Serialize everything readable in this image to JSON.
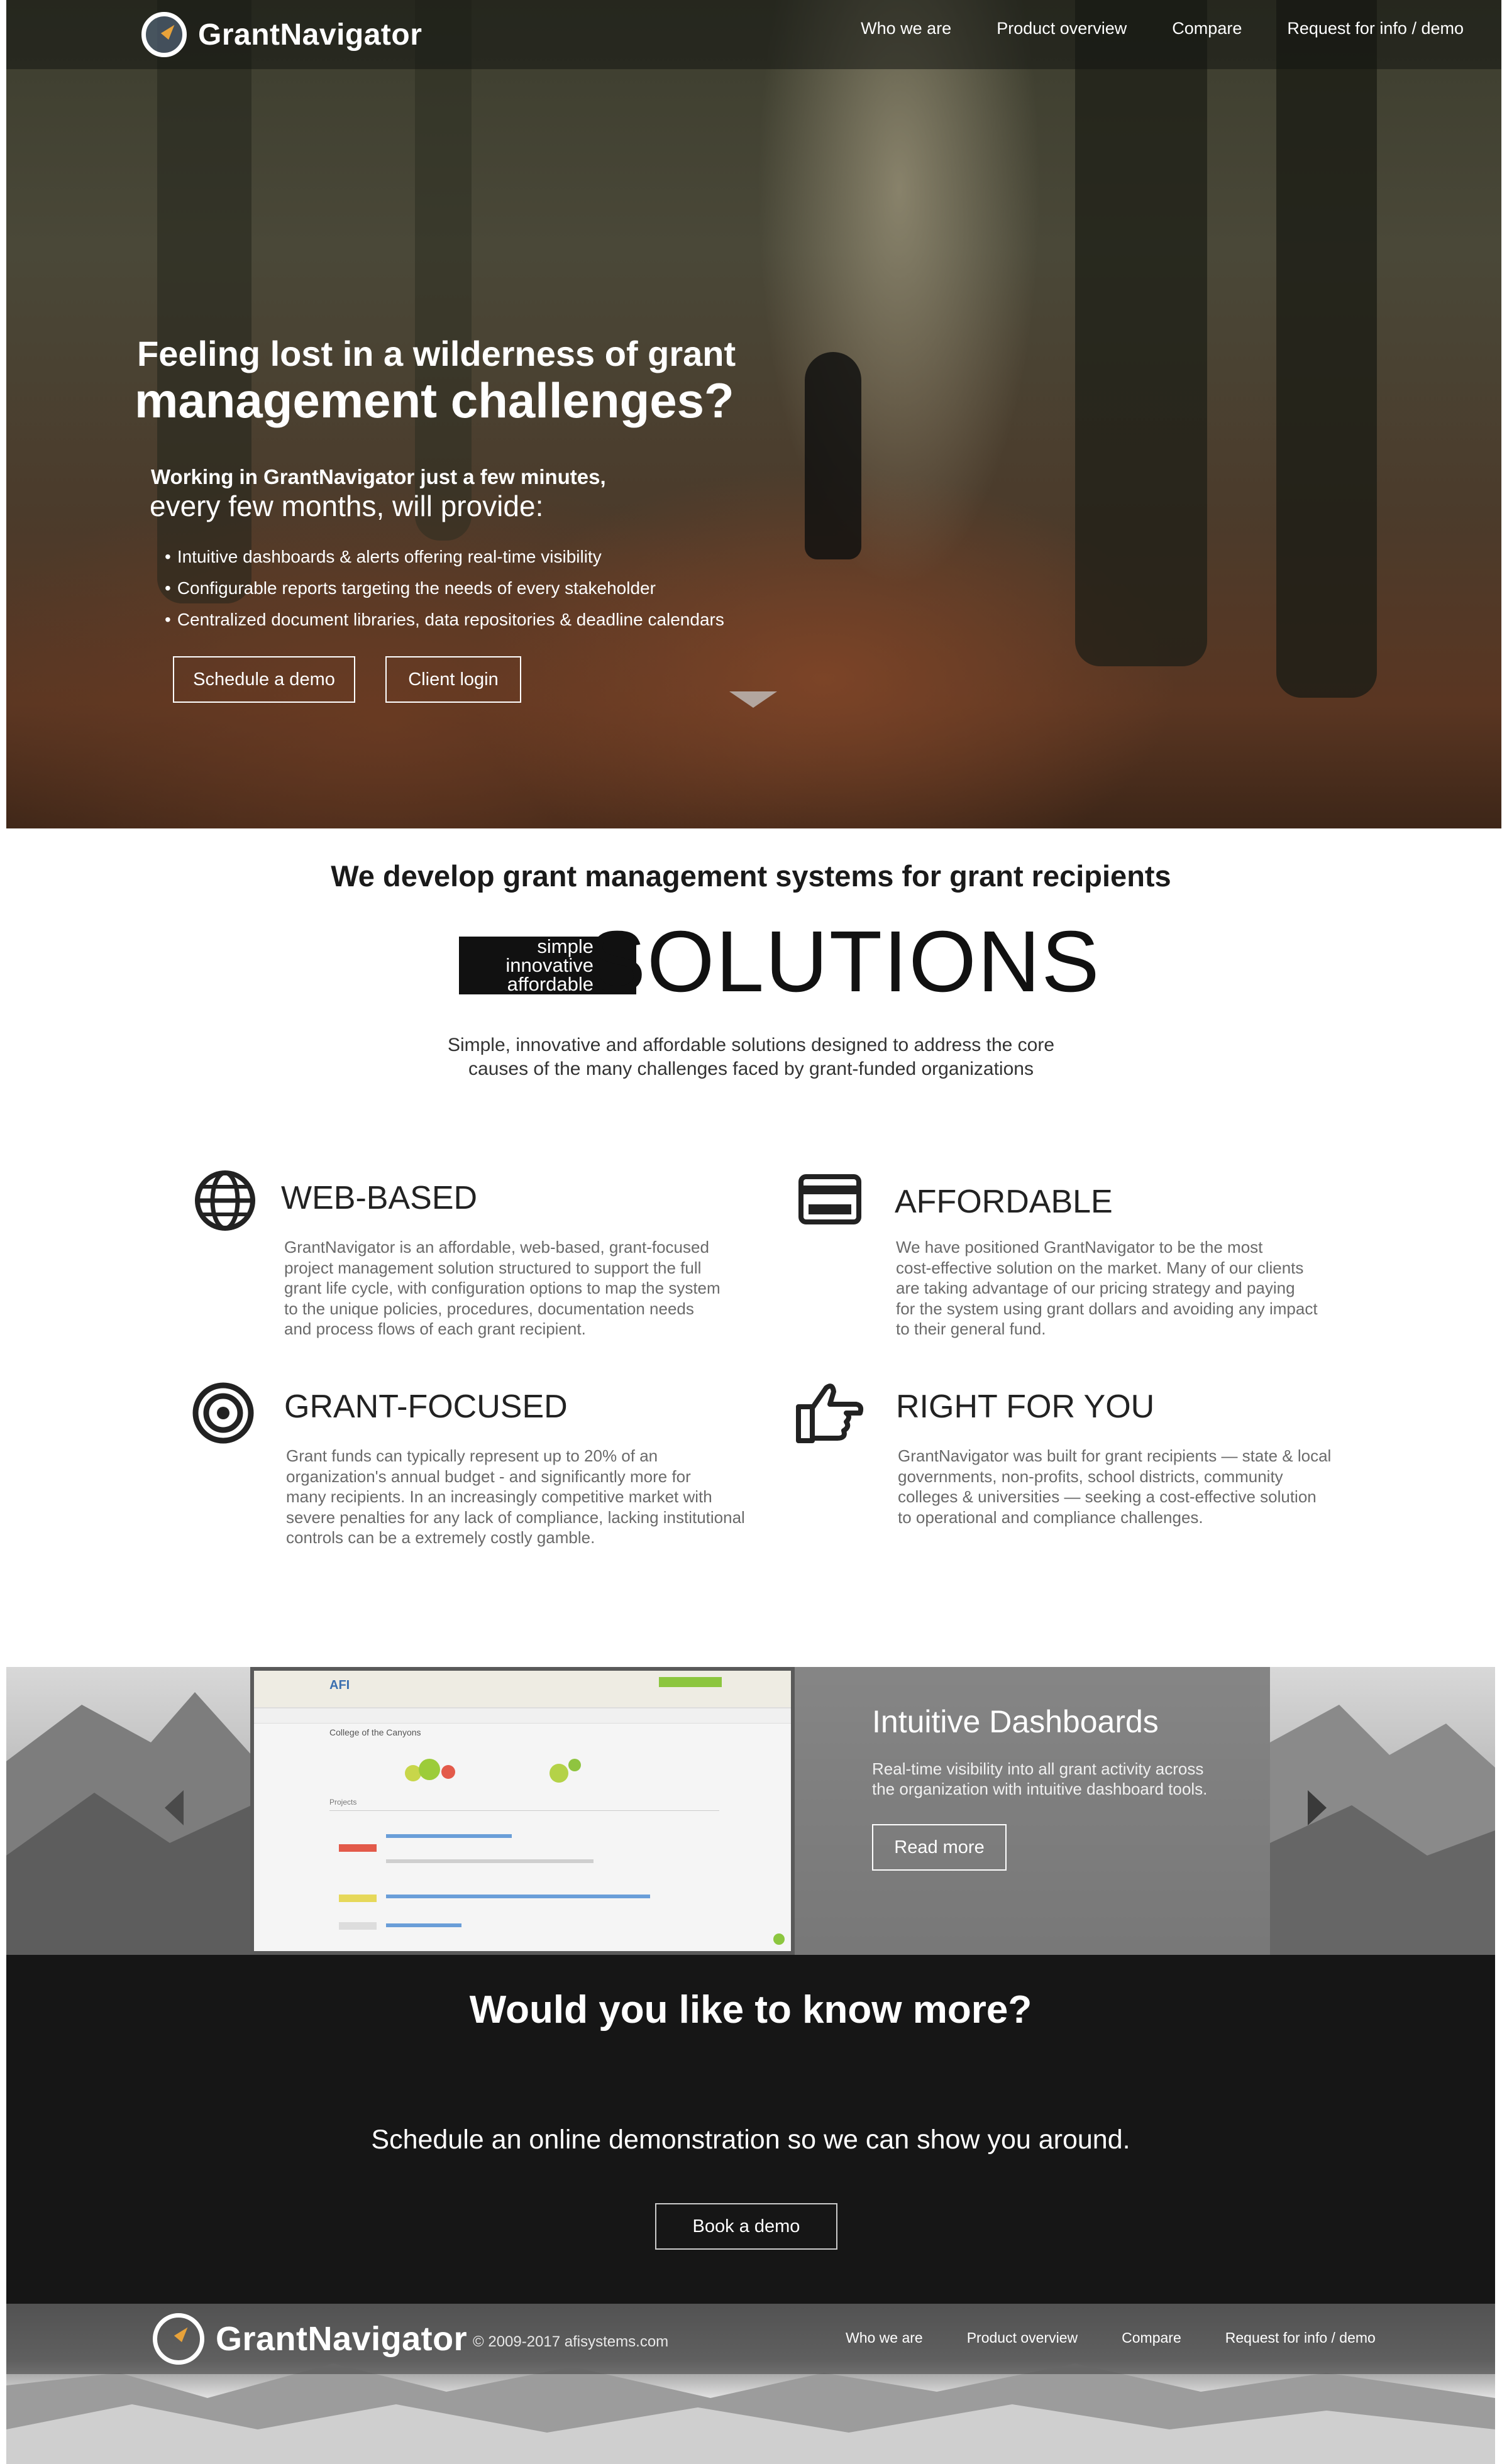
{
  "brand": {
    "name": "GrantNavigator",
    "logo_icon": "compass-icon",
    "accent_color": "#e8a23a"
  },
  "nav": {
    "items": [
      "Who we are",
      "Product overview",
      "Compare",
      "Request for info / demo"
    ]
  },
  "hero": {
    "title_line1": "Feeling lost in a wilderness of grant",
    "title_line2": "management challenges?",
    "sub_line1": "Working in GrantNavigator just a few minutes,",
    "sub_line2": "every few months, will provide:",
    "bullets": [
      "Intuitive dashboards & alerts offering real-time visibility",
      "Configurable reports targeting the needs of every stakeholder",
      "Centralized document libraries, data repositories & deadline calendars"
    ],
    "primary_button": "Schedule a demo",
    "secondary_button": "Client login",
    "scroll_icon": "chevron-down-icon"
  },
  "solutions": {
    "heading": "We develop grant management systems for grant recipients",
    "box_words": [
      "simple",
      "innovative",
      "affordable"
    ],
    "big_word": "SOLUTIONS",
    "desc_line1": "Simple, innovative and affordable solutions designed to address the core",
    "desc_line2": "causes of the many challenges faced by grant-funded organizations"
  },
  "features": [
    {
      "icon": "globe-icon",
      "title": "WEB-BASED",
      "lines": [
        "GrantNavigator is an affordable, web-based, grant-focused",
        "project management solution structured to support the full",
        "grant life cycle, with configuration options to map the system",
        "to the unique policies, procedures, documentation needs",
        "and process flows of each grant recipient."
      ]
    },
    {
      "icon": "credit-card-icon",
      "title": "AFFORDABLE",
      "lines": [
        "We have positioned GrantNavigator to be the most",
        "cost-effective solution on the market. Many of our clients",
        "are taking advantage of our pricing strategy and paying",
        "for the system using grant dollars and avoiding any impact",
        "to their general fund."
      ]
    },
    {
      "icon": "target-icon",
      "title": "GRANT-FOCUSED",
      "lines": [
        "Grant funds can typically represent up to 20% of an",
        "organization's annual budget - and significantly more for",
        "many recipients. In an increasingly competitive market with",
        "severe penalties for any lack of compliance, lacking institutional",
        "controls can be a extremely costly gamble."
      ]
    },
    {
      "icon": "hand-pointing-icon",
      "title": "RIGHT FOR YOU",
      "lines": [
        "GrantNavigator was built for grant recipients — state & local",
        "governments, non-profits, school districts, community",
        "colleges & universities — seeking a cost-effective solution",
        "to operational and compliance challenges."
      ]
    }
  ],
  "carousel": {
    "title": "Intuitive Dashboards",
    "text_line1": "Real-time visibility into all grant activity across",
    "text_line2": "the organization with intuitive dashboard tools.",
    "button": "Read more",
    "prev_icon": "arrow-left-icon",
    "next_icon": "arrow-right-icon",
    "screenshot": {
      "app_logo": "AFI",
      "org_name": "College of the Canyons",
      "section": "Projects"
    }
  },
  "cta": {
    "title": "Would you like to know more?",
    "text": "Schedule an online demonstration so we can show you around.",
    "button": "Book a demo"
  },
  "footer": {
    "copyright": "© 2009-2017 afisystems.com",
    "links": [
      "Who we are",
      "Product overview",
      "Compare",
      "Request for info / demo"
    ]
  }
}
